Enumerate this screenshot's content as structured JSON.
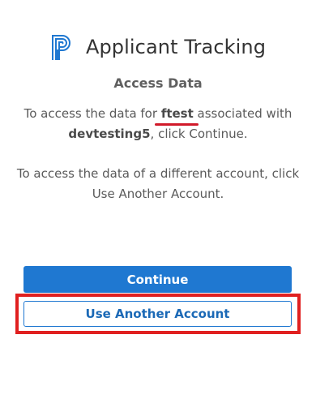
{
  "header": {
    "logo_icon": "powerschool-p-logo-icon",
    "title": "Applicant Tracking"
  },
  "main": {
    "subtitle": "Access Data",
    "message1": {
      "prefix": "To access the data for ",
      "district": "ftest",
      "middle": " associated with ",
      "account": "devtesting5",
      "suffix": ", click Continue."
    },
    "message2": "To access the data of a different account, click Use Another Account."
  },
  "actions": {
    "continue_label": "Continue",
    "another_label": "Use Another Account"
  },
  "colors": {
    "primary": "#1f78d1",
    "highlight": "#e02020"
  }
}
